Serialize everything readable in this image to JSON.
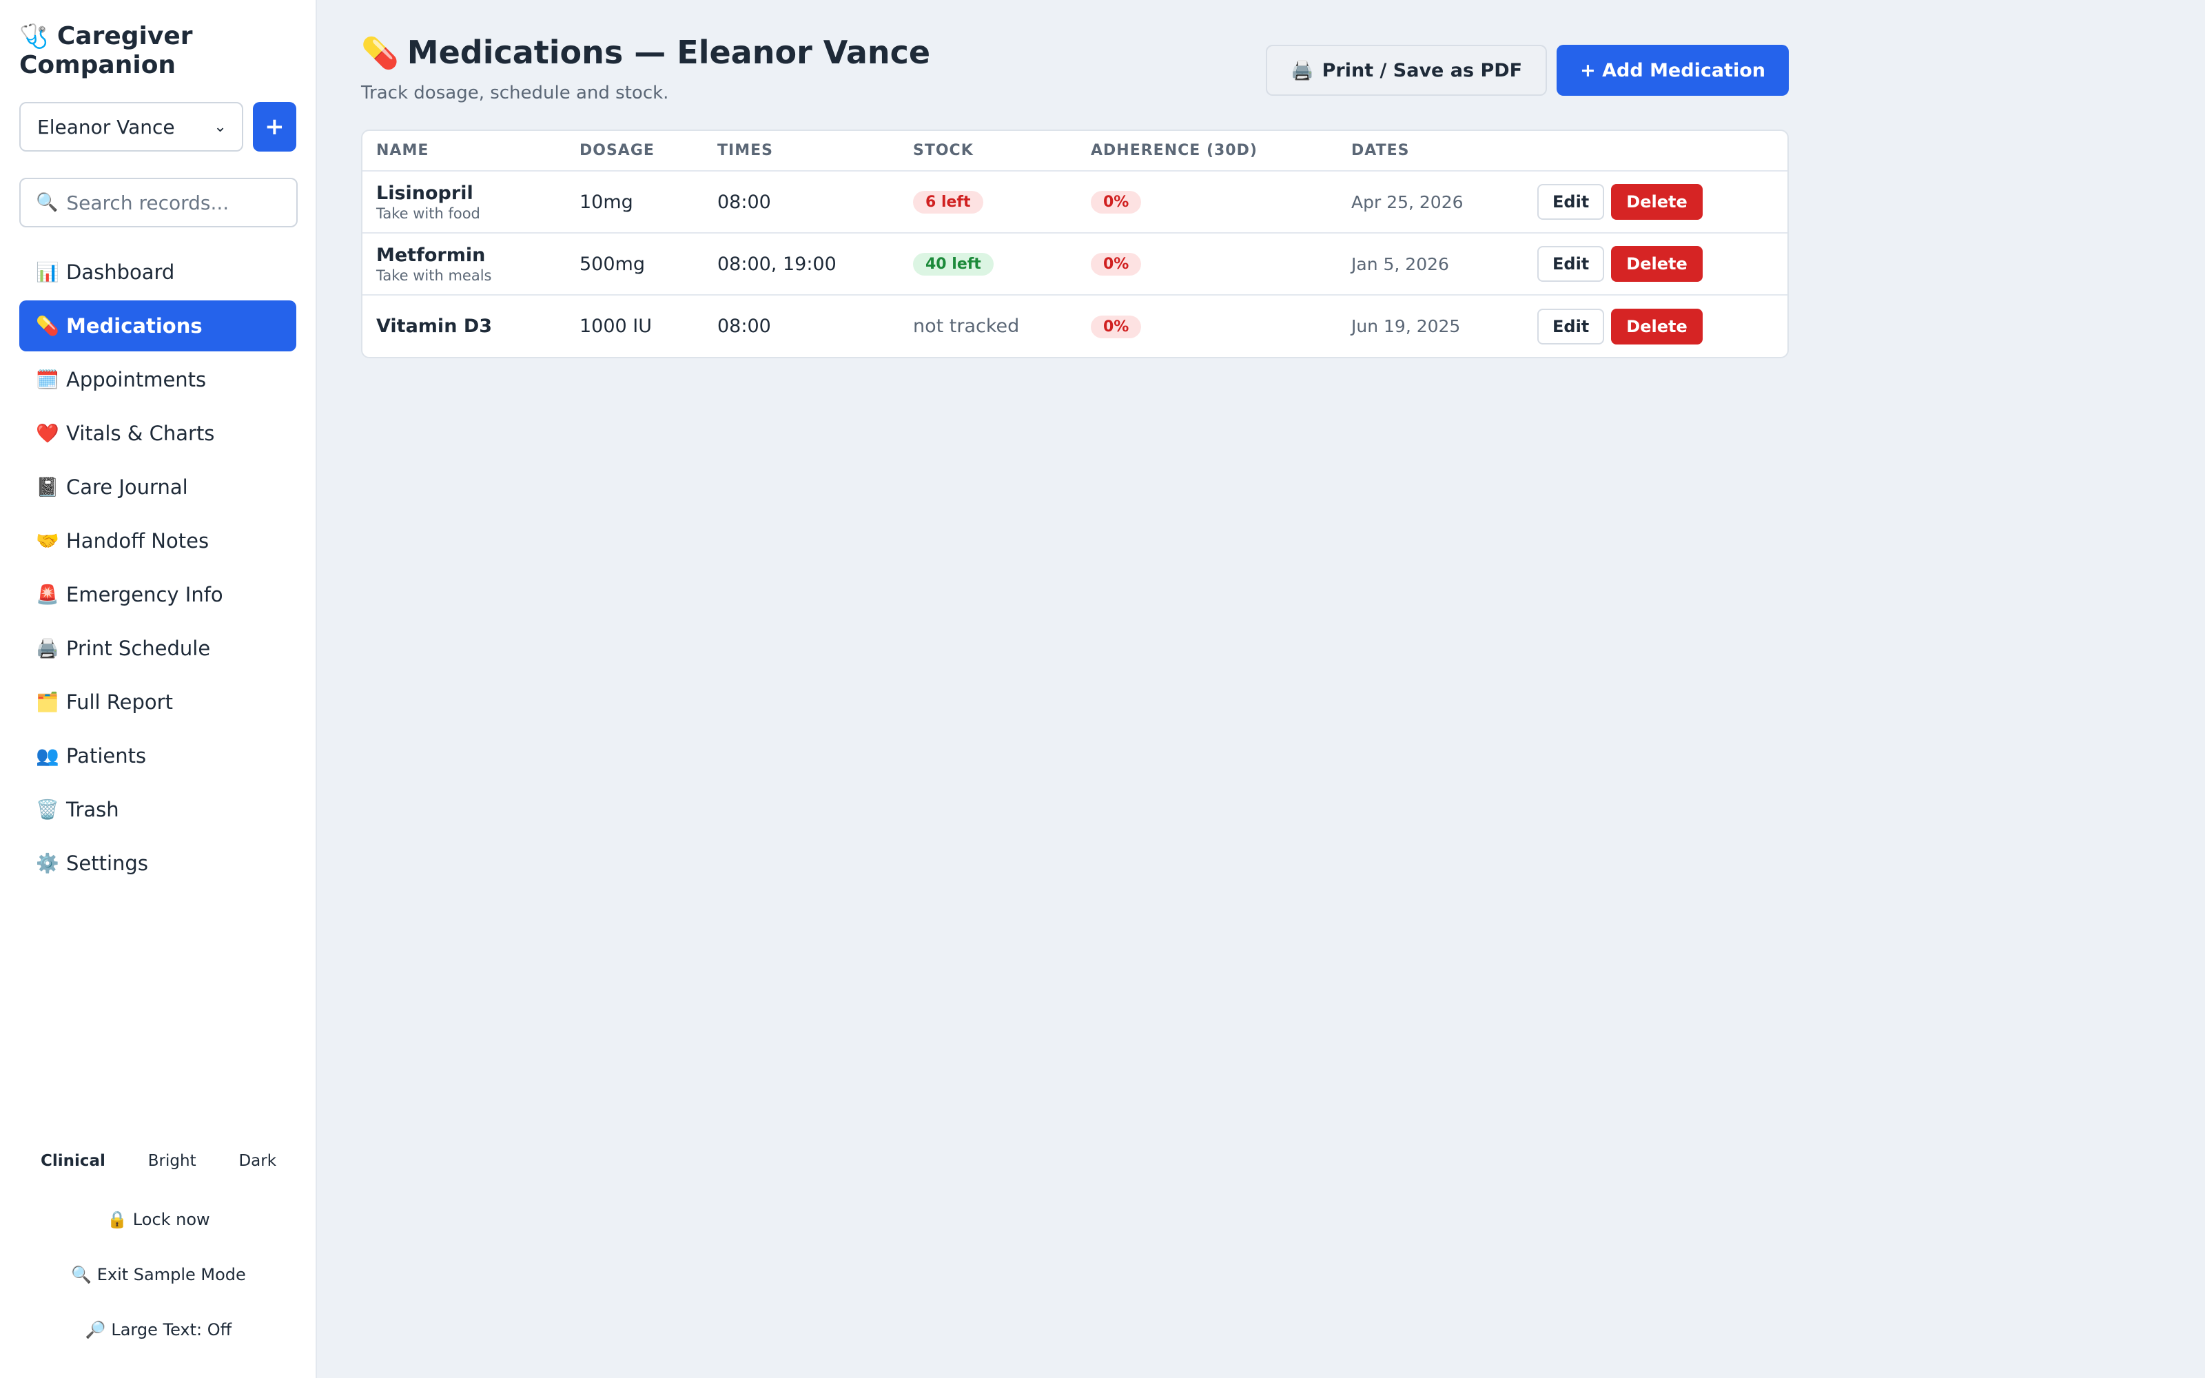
{
  "app": {
    "name": "Caregiver Companion",
    "brand_icon": "stethoscope-icon"
  },
  "sidebar": {
    "patient_selected": "Eleanor Vance",
    "add_patient_label": "+",
    "search_placeholder": "Search records...",
    "items": [
      {
        "icon": "📊",
        "label": "Dashboard"
      },
      {
        "icon": "💊",
        "label": "Medications",
        "active": true
      },
      {
        "icon": "🗓️",
        "label": "Appointments"
      },
      {
        "icon": "❤️",
        "label": "Vitals & Charts"
      },
      {
        "icon": "📓",
        "label": "Care Journal"
      },
      {
        "icon": "🤝",
        "label": "Handoff Notes"
      },
      {
        "icon": "🚨",
        "label": "Emergency Info"
      },
      {
        "icon": "🖨️",
        "label": "Print Schedule"
      },
      {
        "icon": "🗂️",
        "label": "Full Report"
      },
      {
        "icon": "👥",
        "label": "Patients"
      },
      {
        "icon": "🗑️",
        "label": "Trash"
      },
      {
        "icon": "⚙️",
        "label": "Settings"
      }
    ],
    "themes": [
      "Clinical",
      "Bright",
      "Dark"
    ],
    "active_theme": "Clinical",
    "lock_label": "🔒 Lock now",
    "sample_mode_label": "🔍 Exit Sample Mode",
    "large_text_label": "🔎 Large Text: Off"
  },
  "header": {
    "title": "Medications — Eleanor Vance",
    "subtitle": "Track dosage, schedule and stock.",
    "print_label": "Print / Save as PDF",
    "add_label": "+ Add Medication"
  },
  "table": {
    "columns": [
      "NAME",
      "DOSAGE",
      "TIMES",
      "STOCK",
      "ADHERENCE (30D)",
      "DATES"
    ],
    "rows": [
      {
        "name": "Lisinopril",
        "note": "Take with food",
        "dosage": "10mg",
        "times": "08:00",
        "stock": "6 left",
        "stock_status": "low",
        "adherence": "0%",
        "date": "Apr 25, 2026"
      },
      {
        "name": "Metformin",
        "note": "Take with meals",
        "dosage": "500mg",
        "times": "08:00, 19:00",
        "stock": "40 left",
        "stock_status": "ok",
        "adherence": "0%",
        "date": "Jan 5, 2026"
      },
      {
        "name": "Vitamin D3",
        "note": "",
        "dosage": "1000 IU",
        "times": "08:00",
        "stock": "not tracked",
        "stock_status": "none",
        "adherence": "0%",
        "date": "Jun 19, 2025"
      }
    ],
    "edit_label": "Edit",
    "delete_label": "Delete"
  },
  "colors": {
    "accent": "#2563eb",
    "danger": "#d62424",
    "background": "#edf1f6"
  }
}
